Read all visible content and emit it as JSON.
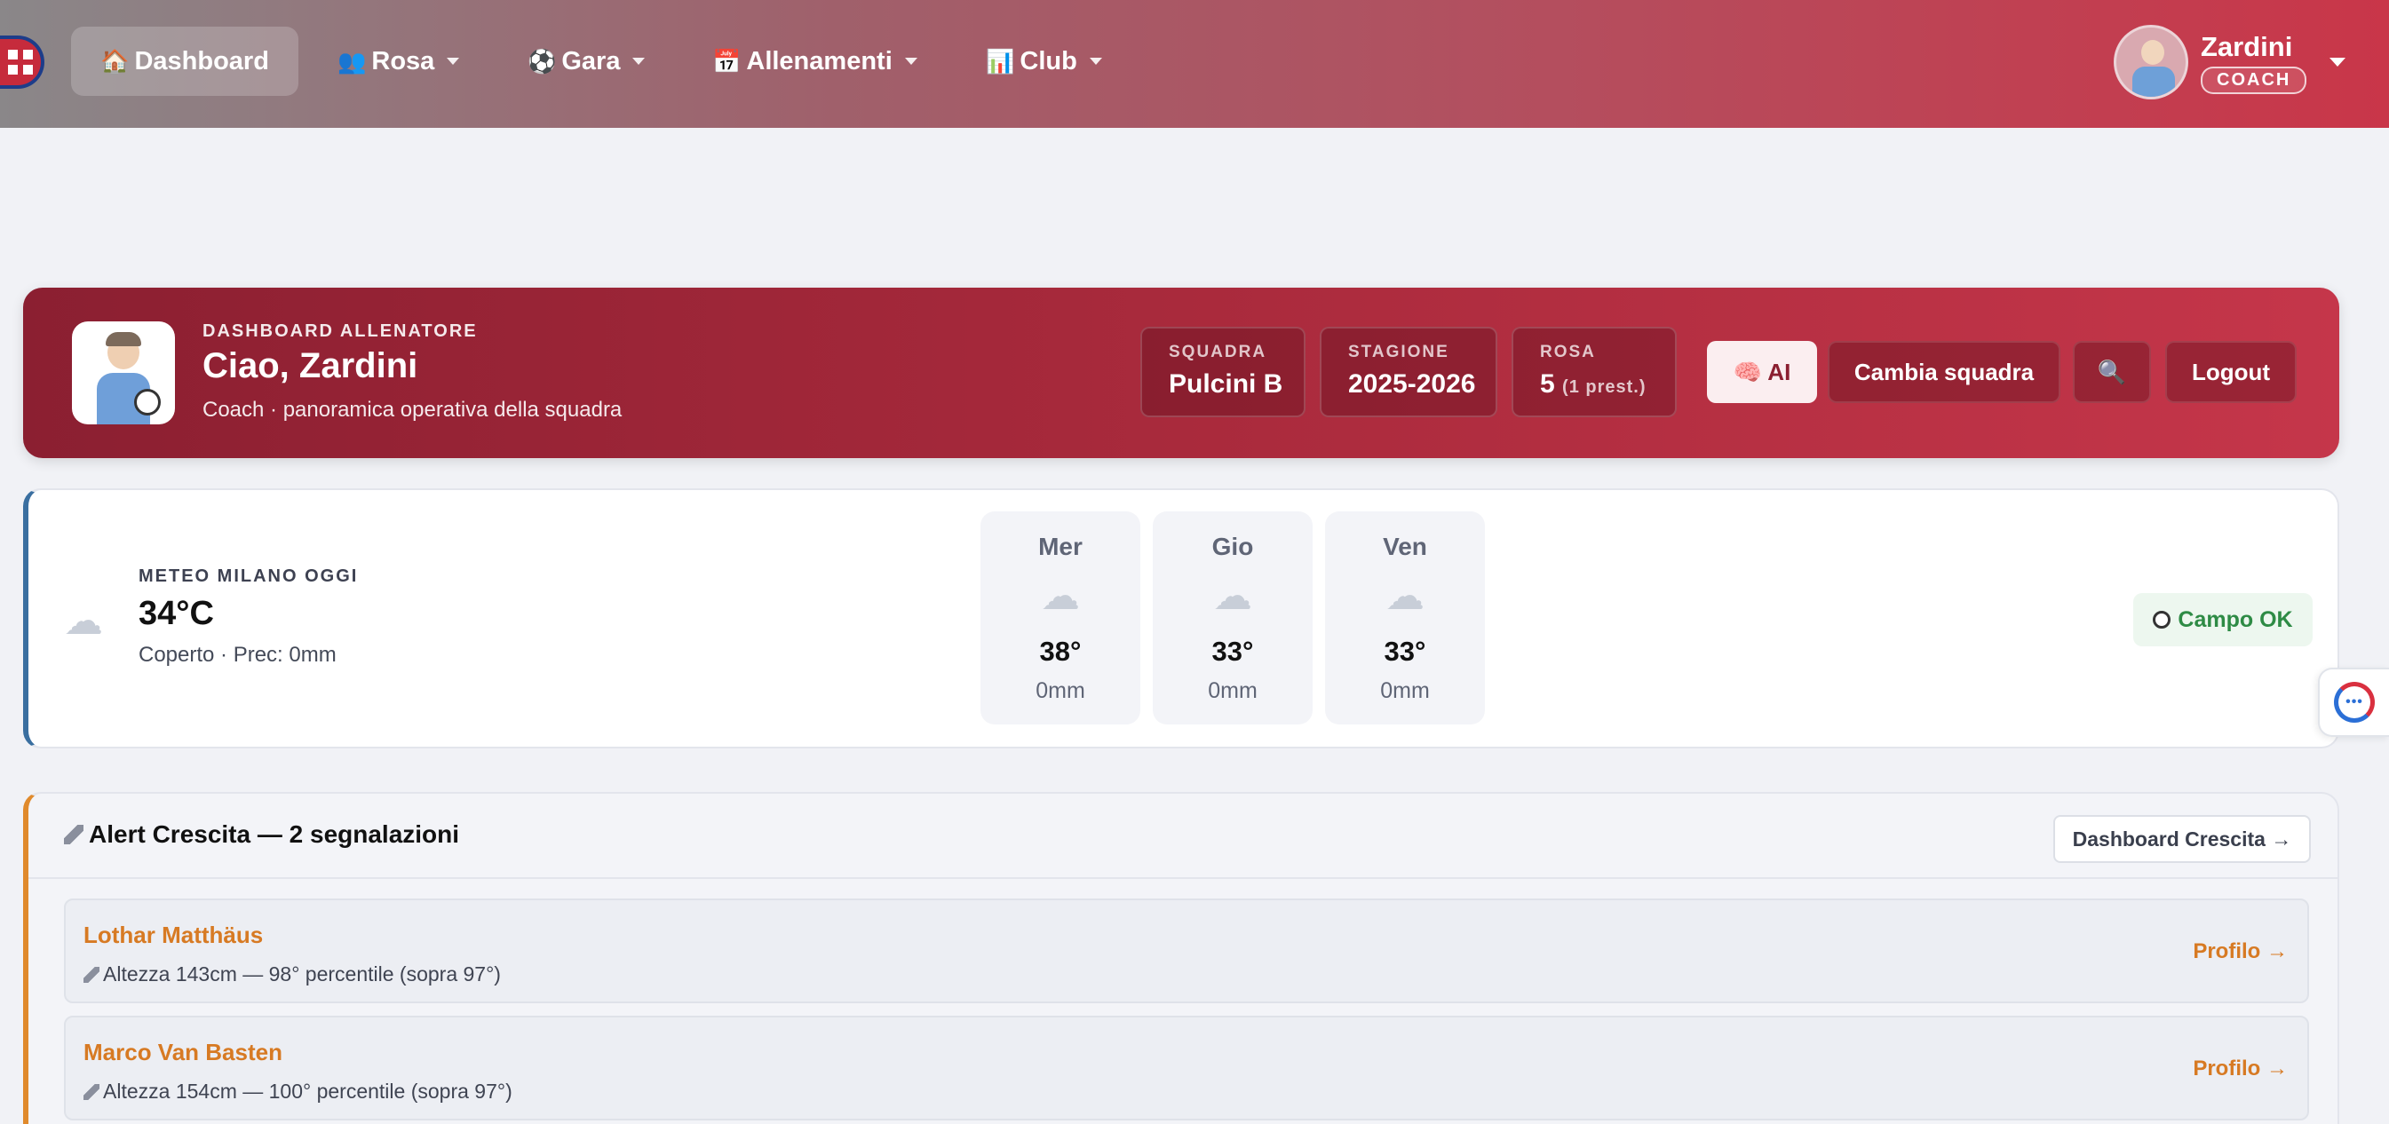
{
  "nav": {
    "items": [
      {
        "icon": "🏠",
        "label": "Dashboard"
      },
      {
        "icon": "👥",
        "label": "Rosa"
      },
      {
        "icon": "⚽",
        "label": "Gara"
      },
      {
        "icon": "📅",
        "label": "Allenamenti"
      },
      {
        "icon": "📊",
        "label": "Club"
      }
    ],
    "user": {
      "name": "Zardini",
      "role": "COACH"
    }
  },
  "hero": {
    "kicker": "DASHBOARD ALLENATORE",
    "title": "Ciao, Zardini",
    "subtitle": "Coach · panoramica operativa della squadra",
    "stats": [
      {
        "label": "SQUADRA",
        "value": "Pulcini B"
      },
      {
        "label": "STAGIONE",
        "value": "2025-2026"
      },
      {
        "label": "ROSA",
        "value": "5",
        "note": "(1 prest.)"
      }
    ],
    "buttons": {
      "ai": "🧠 AI",
      "change_team": "Cambia squadra",
      "search": "🔍",
      "logout": "Logout"
    }
  },
  "weather": {
    "kicker": "METEO MILANO OGGI",
    "temp": "34°C",
    "desc": "Coperto · Prec: 0mm",
    "forecast": [
      {
        "day": "Mer",
        "temp": "38°",
        "rain": "0mm"
      },
      {
        "day": "Gio",
        "temp": "33°",
        "rain": "0mm"
      },
      {
        "day": "Ven",
        "temp": "33°",
        "rain": "0mm"
      }
    ],
    "field_status": "Campo OK",
    "cloud_glyph": "☁"
  },
  "alerts": {
    "title": "Alert Crescita — 2 segnalazioni",
    "button": "Dashboard Crescita →",
    "items": [
      {
        "name": "Lothar Matthäus",
        "detail": "Altezza 143cm — 98° percentile (sopra 97°)",
        "link": "Profilo →"
      },
      {
        "name": "Marco Van Basten",
        "detail": "Altezza 154cm — 100° percentile (sopra 97°)",
        "link": "Profilo →"
      }
    ]
  },
  "colors": {
    "brand_red": "#c93649",
    "accent_orange": "#d77a23",
    "weather_blue": "#3a6fa0",
    "ok_green": "#2e8b45"
  }
}
